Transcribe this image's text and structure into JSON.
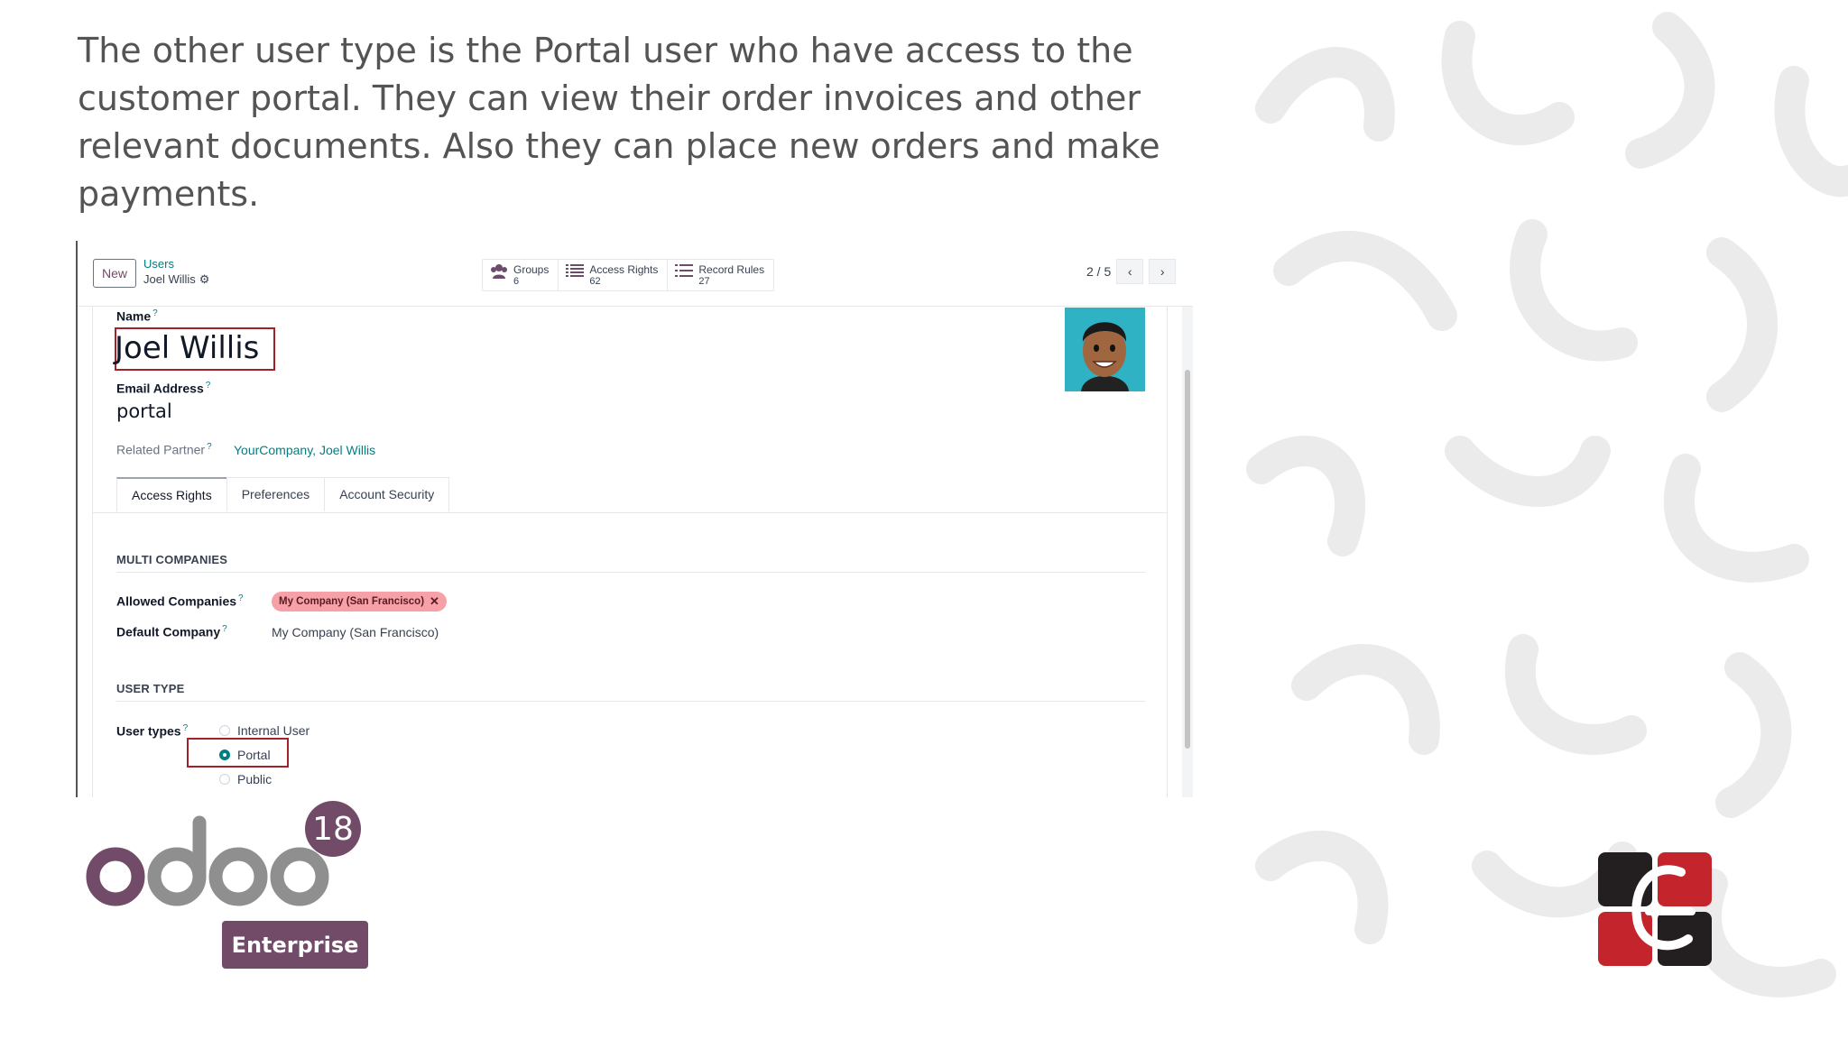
{
  "caption": "The other user type is the Portal user who have access to the customer portal. They can view their order invoices and other relevant documents. Also they can place new orders and make payments.",
  "topbar": {
    "new_label": "New",
    "breadcrumb_parent": "Users",
    "breadcrumb_current": "Joel Willis",
    "stats": [
      {
        "label": "Groups",
        "count": "6",
        "icon": "users-icon"
      },
      {
        "label": "Access Rights",
        "count": "62",
        "icon": "list-icon"
      },
      {
        "label": "Record Rules",
        "count": "27",
        "icon": "list-icon"
      }
    ],
    "pager": "2 / 5"
  },
  "form": {
    "name_label": "Name",
    "name_value": "Joel Willis",
    "email_label": "Email Address",
    "email_value": "portal",
    "partner_label": "Related Partner",
    "partner_value": "YourCompany, Joel Willis",
    "tabs": [
      "Access Rights",
      "Preferences",
      "Account Security"
    ],
    "multi_companies": {
      "title": "MULTI COMPANIES",
      "allowed_label": "Allowed Companies",
      "allowed_tag": "My Company (San Francisco)",
      "default_label": "Default Company",
      "default_value": "My Company (San Francisco)"
    },
    "user_type": {
      "title": "USER TYPE",
      "label": "User types",
      "options": [
        "Internal User",
        "Portal",
        "Public"
      ],
      "selected": "Portal"
    }
  },
  "logo": {
    "word": "odoo",
    "version": "18",
    "edition": "Enterprise"
  },
  "colors": {
    "odoo_purple": "#714b67",
    "odoo_gray": "#8f8f8f",
    "link_teal": "#017e84",
    "highlight_red": "#a32128"
  }
}
